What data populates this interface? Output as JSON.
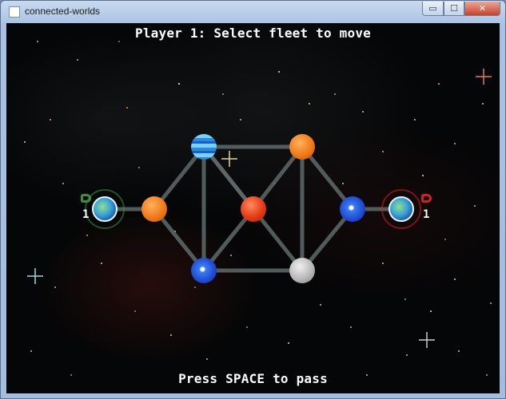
{
  "window": {
    "title": "connected-worlds",
    "controls": {
      "minimize": "▭",
      "maximize": "☐",
      "close": "✕"
    }
  },
  "status": {
    "top": "Player 1: Select fleet to move",
    "bottom": "Press SPACE to pass"
  },
  "colors": {
    "player1": "#3a8f3a",
    "player2": "#d02020",
    "link": "#5f6a6a",
    "text": "#ffffff"
  },
  "planets": [
    {
      "id": "home-left",
      "kind": "earth",
      "owner": "player1",
      "fleet": "1"
    },
    {
      "id": "left-orange",
      "kind": "orange"
    },
    {
      "id": "top-blue",
      "kind": "gas-giant-blue"
    },
    {
      "id": "top-orange",
      "kind": "orange"
    },
    {
      "id": "center-red",
      "kind": "red"
    },
    {
      "id": "right-blue",
      "kind": "swirl-blue"
    },
    {
      "id": "bottom-blue",
      "kind": "swirl-blue"
    },
    {
      "id": "bottom-gray",
      "kind": "gray"
    },
    {
      "id": "home-right",
      "kind": "earth",
      "owner": "player2",
      "fleet": "1"
    }
  ],
  "links": [
    [
      "home-left",
      "left-orange"
    ],
    [
      "left-orange",
      "top-blue"
    ],
    [
      "left-orange",
      "bottom-blue"
    ],
    [
      "top-blue",
      "top-orange"
    ],
    [
      "top-blue",
      "bottom-blue"
    ],
    [
      "top-blue",
      "center-red"
    ],
    [
      "top-blue",
      "bottom-gray"
    ],
    [
      "top-orange",
      "center-red"
    ],
    [
      "top-orange",
      "bottom-gray"
    ],
    [
      "top-orange",
      "right-blue"
    ],
    [
      "center-red",
      "bottom-blue"
    ],
    [
      "bottom-blue",
      "bottom-gray"
    ],
    [
      "bottom-gray",
      "right-blue"
    ],
    [
      "right-blue",
      "home-right"
    ]
  ]
}
